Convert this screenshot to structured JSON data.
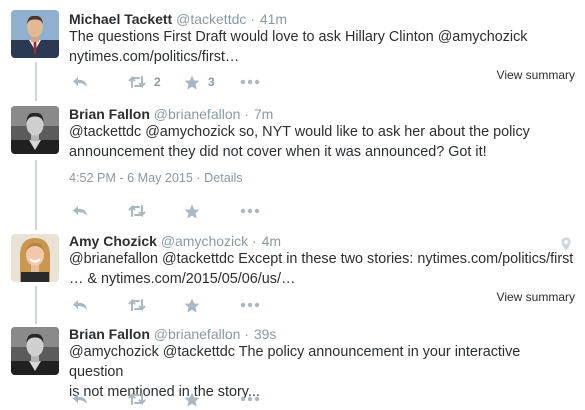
{
  "tweets": [
    {
      "name": "Michael Tackett",
      "handle": "@tackettdc",
      "time": "41m",
      "text_lines": [
        "The questions First Draft would love to ask Hillary Clinton @amychozick",
        "nytimes.com/politics/first…"
      ],
      "retweet_count": "2",
      "like_count": "3",
      "summary_label": "View summary",
      "avatar_icon": "person-in-suit-avatar"
    },
    {
      "name": "Brian Fallon",
      "handle": "@brianefallon",
      "time": "7m",
      "text_lines": [
        "@tackettdc @amychozick so, NYT would like to ask her about the policy",
        "announcement they did not cover when it was announced? Got it!"
      ],
      "timestamp": "4:52 PM - 6 May 2015",
      "details_label": "Details",
      "avatar_icon": "bw-portrait-avatar"
    },
    {
      "name": "Amy Chozick",
      "handle": "@amychozick",
      "time": "4m",
      "text_lines": [
        "@brianefallon @tackettdc Except in these two stories: nytimes.com/politics/first",
        "… & nytimes.com/2015/05/06/us/…"
      ],
      "summary_label": "View summary",
      "avatar_icon": "smiling-woman-avatar"
    },
    {
      "name": "Brian Fallon",
      "handle": "@brianefallon",
      "time": "39s",
      "text_lines": [
        "@amychozick @tackettdc The policy announcement in your interactive question",
        "is not mentioned in the story..."
      ],
      "avatar_icon": "bw-portrait-avatar"
    }
  ],
  "separator": "·",
  "icons": {
    "reply": "reply-arrow-icon",
    "retweet": "retweet-icon",
    "favorite": "star-icon",
    "more": "more-dots-icon",
    "location": "location-pin-icon"
  },
  "colors": {
    "name": "#292f33",
    "muted": "#8899a6",
    "icon": "#aab8c2",
    "thread_line": "#ccd6dd"
  }
}
